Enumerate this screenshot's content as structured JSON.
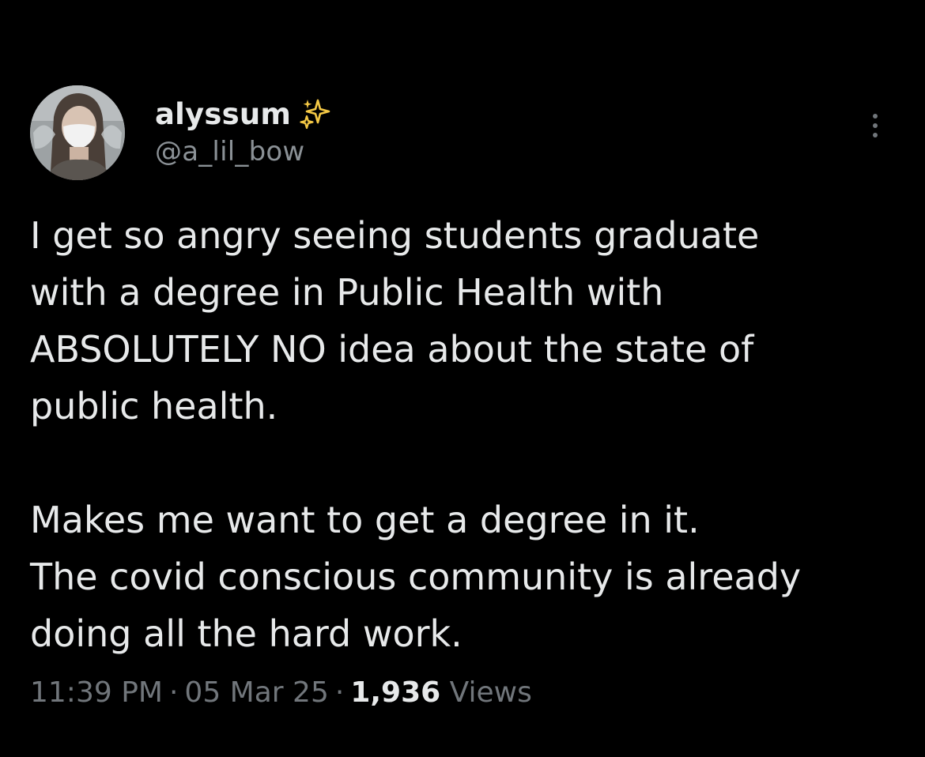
{
  "author": {
    "display_name": "alyssum",
    "handle": "@a_lil_bow",
    "badge_icon": "sparkles-icon"
  },
  "tweet": {
    "paragraph_1": "I get so angry seeing students graduate\nwith a degree in Public Health with\nABSOLUTELY NO idea about the state of\npublic health.",
    "paragraph_2": "Makes me want to get a degree in it.\nThe covid conscious community is already\ndoing all the hard work."
  },
  "meta": {
    "time": "11:39 PM",
    "separator": "·",
    "date": "05 Mar 25",
    "views_count": "1,936",
    "views_label": "Views"
  },
  "colors": {
    "background": "#000000",
    "text_primary": "#e7e9ea",
    "text_secondary": "#71767b",
    "sparkle": "#f5c945"
  },
  "icons": {
    "more": "more-horizontal-icon"
  }
}
